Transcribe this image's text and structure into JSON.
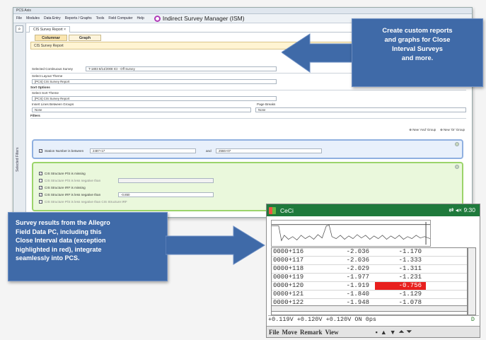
{
  "app": {
    "title": "PCS Axis",
    "menu": [
      "File",
      "Modules",
      "Data Entry",
      "Reports / Graphs",
      "Tools",
      "Field Computer",
      "Help"
    ],
    "product_title": "Indirect Survey Manager (ISM)",
    "doc_tab": "CIS Survey Report"
  },
  "report": {
    "tabs": [
      "Columnar",
      "Graph"
    ],
    "header": "CIS Survey Report",
    "selected_survey_label": "Selected Continuous Survey",
    "selected_survey_value": "T-1803  8/14/2008  ICt - Off Survey",
    "layout_theme_label": "Select Layout Theme",
    "layout_theme_value": "[PCS] CIS Survey Report",
    "sort_options_label": "Sort Options",
    "sort_theme_label": "Select Sort Theme",
    "sort_theme_value": "[PCS] CIS Survey Report",
    "insert_lines_label": "Insert Lines Between Groups",
    "insert_lines_value": "None",
    "page_breaks_label": "Page Breaks",
    "page_breaks_value": "None",
    "filters_label": "Filters",
    "new_and_group": "New 'And' Group",
    "new_or_group": "New 'Or' Group",
    "station_label": "Station Number is between",
    "station_from": "2487+17",
    "station_and": "and",
    "station_to": "2566+07",
    "filters": [
      {
        "label": "CIS Structure P/S is missing",
        "checked": true
      },
      {
        "label": "CIS Structure P/S is less negative than",
        "checked": false
      },
      {
        "label": "CIS Structure IRF is missing",
        "checked": true
      },
      {
        "label": "CIS Structure IRF is less negative than",
        "checked": true,
        "value": "-0.850"
      },
      {
        "label": "CIS Structure P/S is less negative than  CIS Structure IRF",
        "checked": false
      }
    ],
    "side_label": "Selected Filters"
  },
  "callouts": {
    "top": [
      "Create custom reports",
      "and graphs for Close",
      "Interval Surveys",
      "and more."
    ],
    "bottom": [
      "Survey results from the Allegro",
      "Field Data PC, including this",
      "Close Interval data (exception",
      "highlighted in red), integrate",
      "seamlessly into PCS."
    ]
  },
  "device": {
    "app_title": "CeCi",
    "clock": "9:30",
    "rows": [
      {
        "station": "0000+116",
        "a": "-2.036",
        "b": "-1.170",
        "highlight": false
      },
      {
        "station": "0000+117",
        "a": "-2.036",
        "b": "-1.333",
        "highlight": false
      },
      {
        "station": "0000+118",
        "a": "-2.029",
        "b": "-1.311",
        "highlight": false
      },
      {
        "station": "0000+119",
        "a": "-1.977",
        "b": "-1.231",
        "highlight": false
      },
      {
        "station": "0000+120",
        "a": "-1.919",
        "b": "-0.756",
        "highlight": true
      },
      {
        "station": "0000+121",
        "a": "-1.840",
        "b": "-1.129",
        "highlight": false
      },
      {
        "station": "0000+122",
        "a": "-1.948",
        "b": "-1.078",
        "highlight": false
      }
    ],
    "status": "+0.119V  +0.120V  +0.120V  ON  0ps",
    "status_right": "D",
    "menu": [
      "File",
      "Move",
      "Remark",
      "View"
    ]
  },
  "colors": {
    "callout": "#3f6aa8",
    "highlight": "#e8201e",
    "device_titlebar": "#1f7a3c"
  }
}
